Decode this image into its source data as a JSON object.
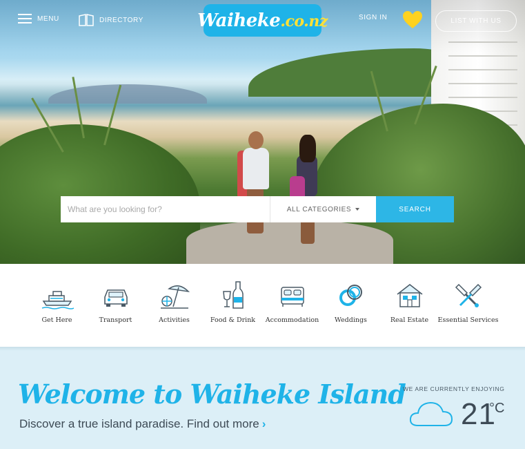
{
  "nav": {
    "menu_label": "MENU",
    "directory_label": "DIRECTORY",
    "logo_text_main": "Waiheke",
    "logo_text_domain": ".co.nz",
    "sign_in_label": "SIGN IN",
    "list_with_us_label": "LIST WITH US"
  },
  "search": {
    "placeholder": "What are you looking for?",
    "category_label": "ALL CATEGORIES",
    "button_label": "SEARCH"
  },
  "categories": [
    {
      "label": "Get Here",
      "icon": "ferry-icon"
    },
    {
      "label": "Transport",
      "icon": "car-icon"
    },
    {
      "label": "Activities",
      "icon": "beach-umbrella-icon"
    },
    {
      "label": "Food & Drink",
      "icon": "wine-glass-bottle-icon"
    },
    {
      "label": "Accommodation",
      "icon": "bed-icon"
    },
    {
      "label": "Weddings",
      "icon": "rings-icon"
    },
    {
      "label": "Real Estate",
      "icon": "house-icon"
    },
    {
      "label": "Essential Services",
      "icon": "tools-icon"
    }
  ],
  "welcome": {
    "title": "Welcome to Waiheke Island",
    "subtitle": "Discover a true island paradise. Find out more",
    "chevron": "›"
  },
  "weather": {
    "label": "WE ARE CURRENTLY ENJOYING",
    "icon": "cloud-icon",
    "temperature": "21",
    "unit": "°C"
  },
  "colors": {
    "accent": "#1fb3e8",
    "heart": "#ffd21f",
    "welcome_bg": "#dceff7"
  }
}
